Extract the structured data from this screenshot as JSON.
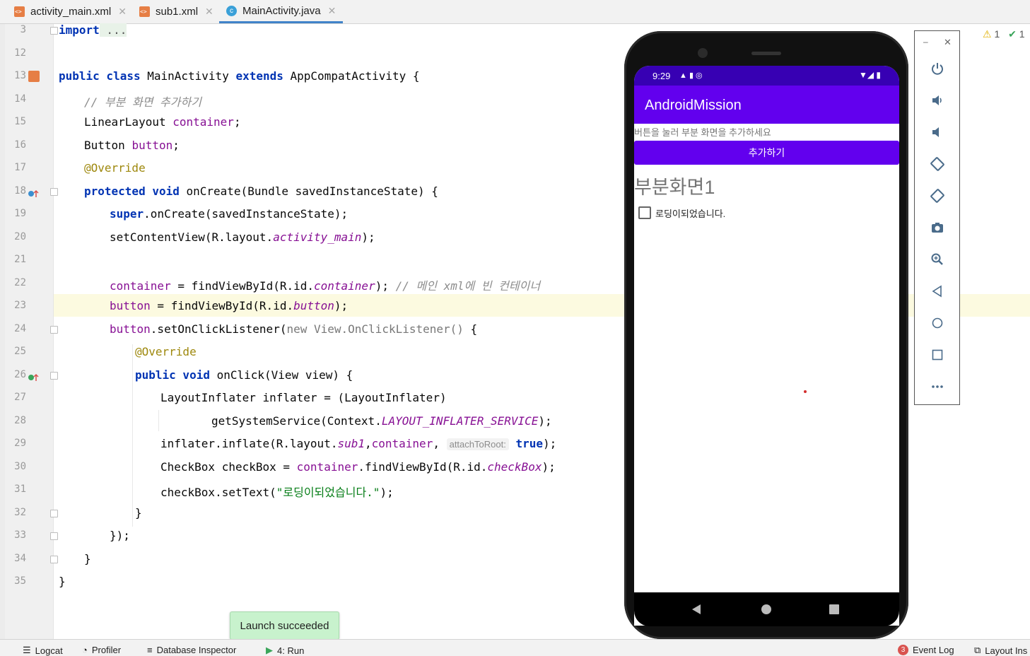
{
  "tabs": [
    {
      "label": "activity_main.xml",
      "icon": "xml-file-icon"
    },
    {
      "label": "sub1.xml",
      "icon": "xml-file-icon"
    },
    {
      "label": "MainActivity.java",
      "icon": "java-class-icon",
      "active": true
    }
  ],
  "inspection": {
    "warnings": "1",
    "ok": "1"
  },
  "line_numbers": [
    "3",
    "12",
    "13",
    "14",
    "15",
    "16",
    "17",
    "18",
    "19",
    "20",
    "21",
    "22",
    "23",
    "24",
    "25",
    "26",
    "27",
    "28",
    "29",
    "30",
    "31",
    "32",
    "33",
    "34",
    "35"
  ],
  "code": {
    "l3": {
      "kw": "import",
      "rest": " ..."
    },
    "l13": {
      "kw1": "public class",
      "name": " MainActivity ",
      "kw2": "extends",
      "rest": " AppCompatActivity {"
    },
    "l14": "// 부분 화면 추가하기",
    "l15": {
      "type": "LinearLayout ",
      "field": "container",
      "end": ";"
    },
    "l16": {
      "type": "Button ",
      "field": "button",
      "end": ";"
    },
    "l17": "@Override",
    "l18": {
      "kw": "protected void",
      "rest": " onCreate(Bundle savedInstanceState) {"
    },
    "l19": {
      "kw": "super",
      "rest": ".onCreate(savedInstanceState);"
    },
    "l20": {
      "pre": "setContentView(R.layout.",
      "ital": "activity_main",
      "post": ");"
    },
    "l22": {
      "field": "container",
      "mid": " = findViewById(R.id.",
      "ital": "container",
      "post": "); ",
      "comment": "// 메인 xml에 빈 컨테이너"
    },
    "l23": {
      "field": "button",
      "mid": " = findViewById(R.id.",
      "ital": "button",
      "post": ");"
    },
    "l24": {
      "field": "button",
      "mid": ".setOnClickListener(",
      "gray": "new View.OnClickListener()",
      "post": " {"
    },
    "l25": "@Override",
    "l26": {
      "kw": "public void",
      "rest": " onClick(View view) {"
    },
    "l27": "LayoutInflater inflater = (LayoutInflater)",
    "l28": {
      "pre": "getSystemService(Context.",
      "ital": "LAYOUT_INFLATER_SERVICE",
      "post": ");"
    },
    "l29": {
      "pre": "inflater.inflate(R.layout.",
      "ital": "sub1",
      "comma": ",",
      "field": "container",
      "comma2": ", ",
      "hint": "attachToRoot:",
      "kw": " true",
      "post": ");"
    },
    "l30": {
      "pre": "CheckBox checkBox = ",
      "field": "container",
      "mid": ".findViewById(R.id.",
      "ital": "checkBox",
      "post": ");"
    },
    "l31": {
      "pre": "checkBox.setText(",
      "str": "\"로딩이되었습니다.\"",
      "post": ");"
    },
    "l32": "}",
    "l33": "});",
    "l34": "}",
    "l35": "}"
  },
  "emulator": {
    "time": "9:29",
    "app_title": "AndroidMission",
    "hint_text": "버튼을 눌러 부분 화면을 추가하세요",
    "button_label": "추가하기",
    "sub_title": "부분화면1",
    "checkbox_label": "로딩이되었습니다.",
    "primary_color": "#6200ee",
    "status_color": "#3700b3"
  },
  "emulator_tools": [
    "power-icon",
    "volume-up-icon",
    "volume-down-icon",
    "rotate-left-icon",
    "rotate-right-icon",
    "camera-icon",
    "zoom-icon",
    "back-icon",
    "home-icon",
    "overview-icon",
    "more-icon"
  ],
  "bottom_bar": {
    "logcat": "Logcat",
    "profiler": "Profiler",
    "db_inspector": "Database Inspector",
    "run": "4: Run",
    "event_log": "Event Log",
    "event_count": "3",
    "layout_inspector": "Layout Ins"
  },
  "toast": "Launch succeeded"
}
